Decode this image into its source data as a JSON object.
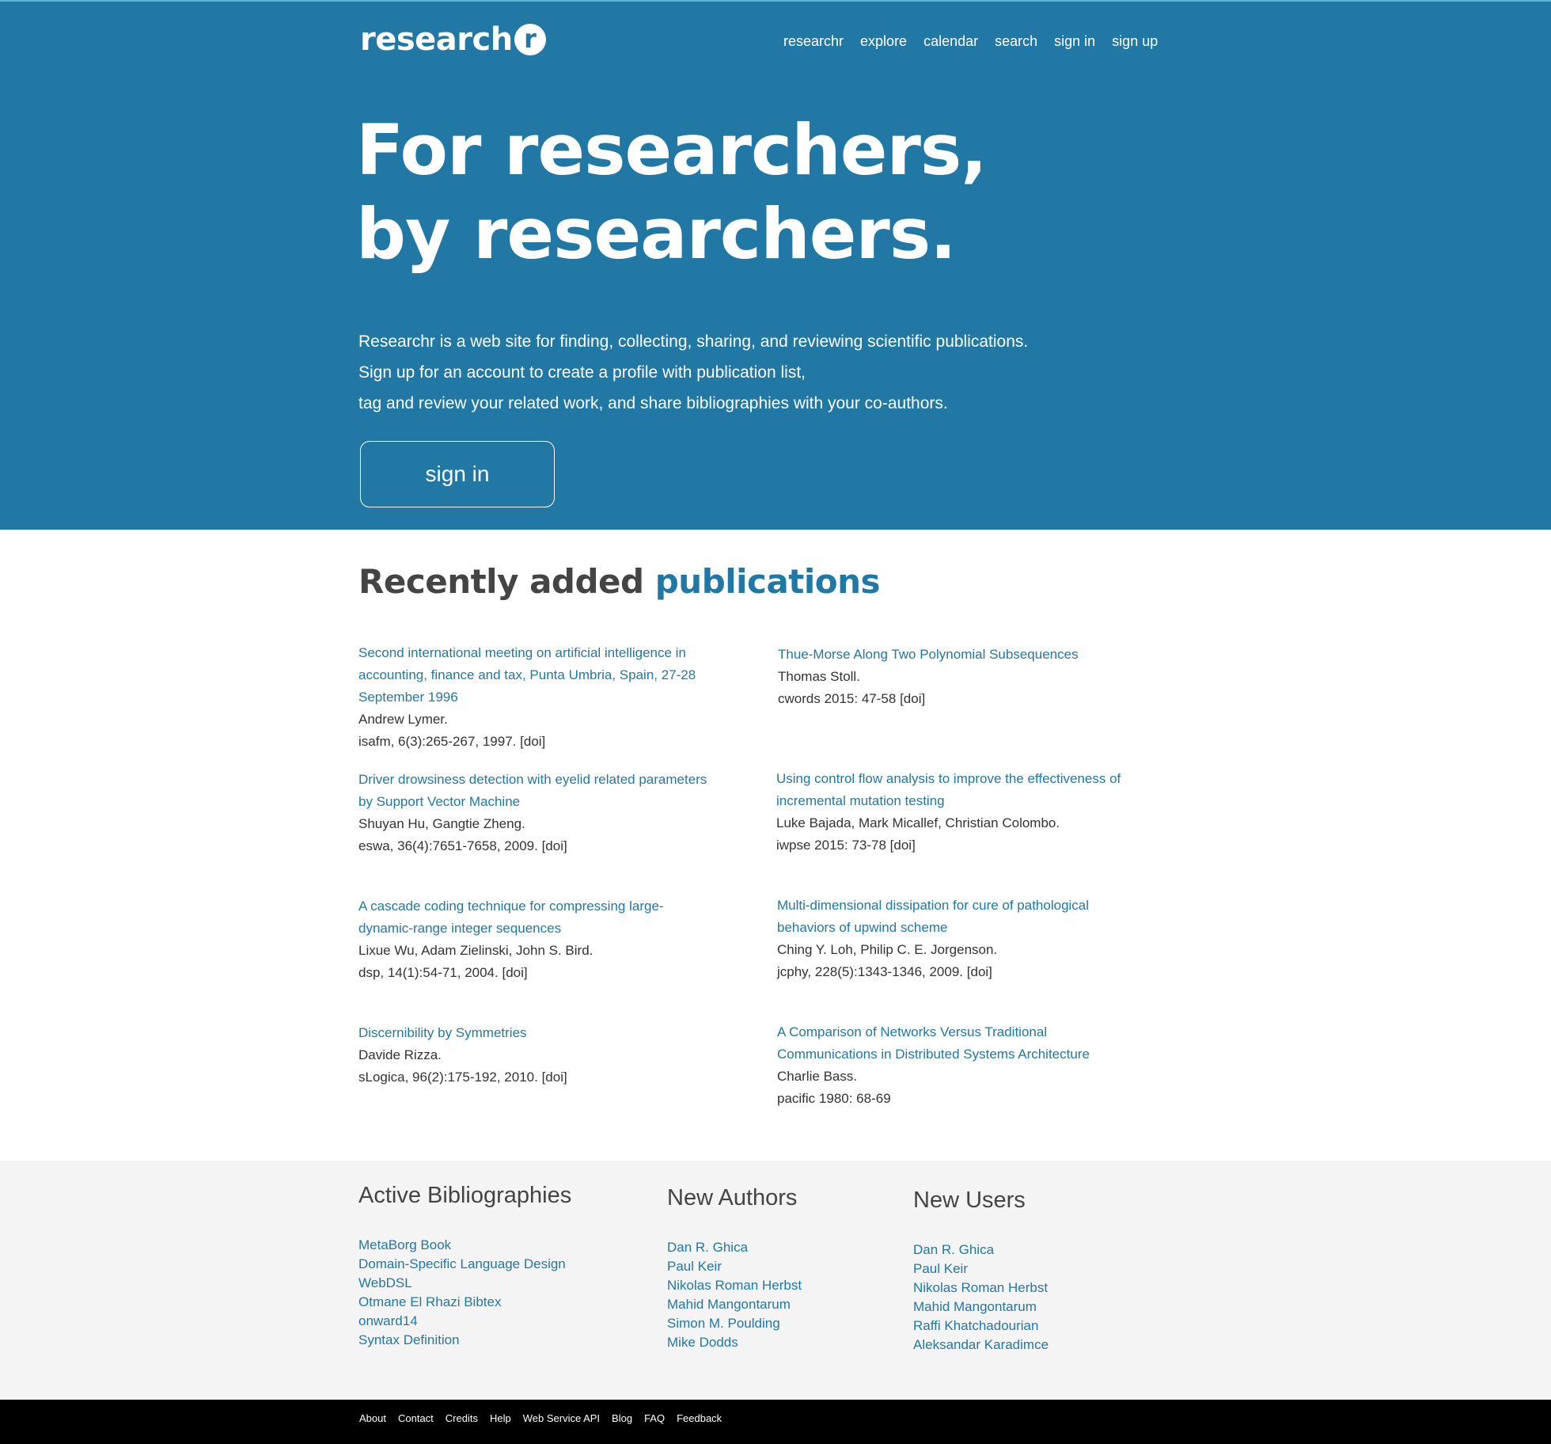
{
  "header": {
    "logo_text": "research",
    "logo_badge": "r",
    "nav": [
      "researchr",
      "explore",
      "calendar",
      "search",
      "sign in",
      "sign up"
    ]
  },
  "hero": {
    "headline_line1": "For researchers,",
    "headline_line2": "by researchers.",
    "intro_line1": "Researchr is a web site for finding, collecting, sharing, and reviewing scientific publications.",
    "intro_line2": "Sign up for an account to create a profile with publication list,",
    "intro_line3": "tag and review your related work, and share bibliographies with your co-authors.",
    "signin_label": "sign in"
  },
  "recent": {
    "title_part1": "Recently added",
    "title_part2": "publications",
    "left": [
      {
        "title": "Second international meeting on artificial intelligence in accounting, finance and tax, Punta Umbria, Spain, 27-28 September 1996",
        "authors": "Andrew Lymer.",
        "venue": "isafm, 6(3):265-267, 1997.",
        "doi": "[doi]"
      },
      {
        "title": "Driver drowsiness detection with eyelid related parameters by Support Vector Machine",
        "authors": "Shuyan Hu, Gangtie Zheng.",
        "venue": "eswa, 36(4):7651-7658, 2009.",
        "doi": "[doi]"
      },
      {
        "title": "A cascade coding technique for compressing large-dynamic-range integer sequences",
        "authors": "Lixue Wu, Adam Zielinski, John S. Bird.",
        "venue": "dsp, 14(1):54-71, 2004.",
        "doi": "[doi]"
      },
      {
        "title": "Discernibility by Symmetries",
        "authors": "Davide Rizza.",
        "venue": "sLogica, 96(2):175-192, 2010.",
        "doi": "[doi]"
      }
    ],
    "right": [
      {
        "title": "Thue-Morse Along Two Polynomial Subsequences",
        "authors": "Thomas Stoll.",
        "venue": "cwords 2015: 47-58",
        "doi": "[doi]"
      },
      {
        "title": "Using control flow analysis to improve the effectiveness of incremental mutation testing",
        "authors": "Luke Bajada, Mark Micallef, Christian Colombo.",
        "venue": "iwpse 2015: 73-78",
        "doi": "[doi]"
      },
      {
        "title": "Multi-dimensional dissipation for cure of pathological behaviors of upwind scheme",
        "authors": "Ching Y. Loh, Philip C. E. Jorgenson.",
        "venue": "jcphy, 228(5):1343-1346, 2009.",
        "doi": "[doi]"
      },
      {
        "title": "A Comparison of Networks Versus Traditional Communications in Distributed Systems Architecture",
        "authors": "Charlie Bass.",
        "venue": "pacific 1980: 68-69",
        "doi": ""
      }
    ]
  },
  "lists": {
    "bibliographies": {
      "title": "Active Bibliographies",
      "items": [
        "MetaBorg Book",
        "Domain-Specific Language Design",
        "WebDSL",
        "Otmane El Rhazi Bibtex",
        "onward14",
        "Syntax Definition"
      ]
    },
    "authors": {
      "title": "New Authors",
      "items": [
        "Dan R. Ghica",
        "Paul Keir",
        "Nikolas Roman Herbst",
        "Mahid Mangontarum",
        "Simon M. Poulding",
        "Mike Dodds"
      ]
    },
    "users": {
      "title": "New Users",
      "items": [
        "Dan R. Ghica",
        "Paul Keir",
        "Nikolas Roman Herbst",
        "Mahid Mangontarum",
        "Raffi Khatchadourian",
        "Aleksandar Karadimce"
      ]
    }
  },
  "footer": {
    "links": [
      "About",
      "Contact",
      "Credits",
      "Help",
      "Web Service API",
      "Blog",
      "FAQ",
      "Feedback"
    ]
  }
}
